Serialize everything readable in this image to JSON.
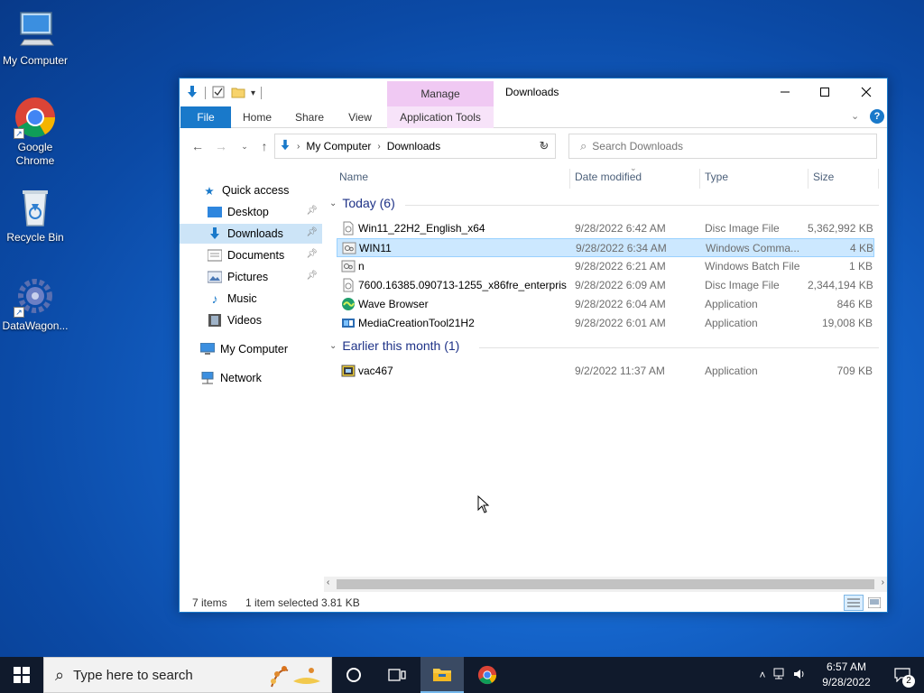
{
  "desktop": {
    "icons": [
      {
        "label": "My Computer"
      },
      {
        "label": "Google Chrome"
      },
      {
        "label": "Recycle Bin"
      },
      {
        "label": "DataWagon..."
      }
    ]
  },
  "window": {
    "title": "Downloads",
    "contextual_tab": "Manage",
    "contextual_tab_group": "Application Tools",
    "ribbon_tabs": [
      "File",
      "Home",
      "Share",
      "View"
    ],
    "address": {
      "crumbs": [
        "My Computer",
        "Downloads"
      ]
    },
    "search": {
      "placeholder": "Search Downloads"
    },
    "nav_pane": {
      "quick_access": "Quick access",
      "items": [
        {
          "label": "Desktop",
          "pinned": true
        },
        {
          "label": "Downloads",
          "pinned": true,
          "selected": true
        },
        {
          "label": "Documents",
          "pinned": true
        },
        {
          "label": "Pictures",
          "pinned": true
        },
        {
          "label": "Music",
          "pinned": false
        },
        {
          "label": "Videos",
          "pinned": false
        }
      ],
      "my_computer": "My Computer",
      "network": "Network"
    },
    "columns": {
      "name": "Name",
      "date": "Date modified",
      "type": "Type",
      "size": "Size"
    },
    "groups": [
      {
        "label": "Today (6)",
        "files": [
          {
            "name": "Win11_22H2_English_x64",
            "date": "9/28/2022 6:42 AM",
            "type": "Disc Image File",
            "size": "5,362,992 KB",
            "icon": "disc-image-icon"
          },
          {
            "name": "WIN11",
            "date": "9/28/2022 6:34 AM",
            "type": "Windows Comma...",
            "size": "4 KB",
            "icon": "batch-file-icon",
            "selected": true
          },
          {
            "name": "n",
            "date": "9/28/2022 6:21 AM",
            "type": "Windows Batch File",
            "size": "1 KB",
            "icon": "batch-file-icon"
          },
          {
            "name": "7600.16385.090713-1255_x86fre_enterpris...",
            "date": "9/28/2022 6:09 AM",
            "type": "Disc Image File",
            "size": "2,344,194 KB",
            "icon": "disc-image-icon"
          },
          {
            "name": "Wave Browser",
            "date": "9/28/2022 6:04 AM",
            "type": "Application",
            "size": "846 KB",
            "icon": "wave-browser-icon"
          },
          {
            "name": "MediaCreationTool21H2",
            "date": "9/28/2022 6:01 AM",
            "type": "Application",
            "size": "19,008 KB",
            "icon": "media-creation-tool-icon"
          }
        ]
      },
      {
        "label": "Earlier this month (1)",
        "files": [
          {
            "name": "vac467",
            "date": "9/2/2022 11:37 AM",
            "type": "Application",
            "size": "709 KB",
            "icon": "application-icon"
          }
        ]
      }
    ],
    "status": {
      "items": "7 items",
      "selected": "1 item selected",
      "size": "3.81 KB"
    }
  },
  "taskbar": {
    "search_placeholder": "Type here to search",
    "clock_time": "6:57 AM",
    "clock_date": "9/28/2022",
    "notification_count": "2"
  },
  "colors": {
    "accent": "#1979ca",
    "selection": "#cce8ff",
    "manage_tab": "#f0c9f3",
    "taskbar": "#101a2c"
  }
}
